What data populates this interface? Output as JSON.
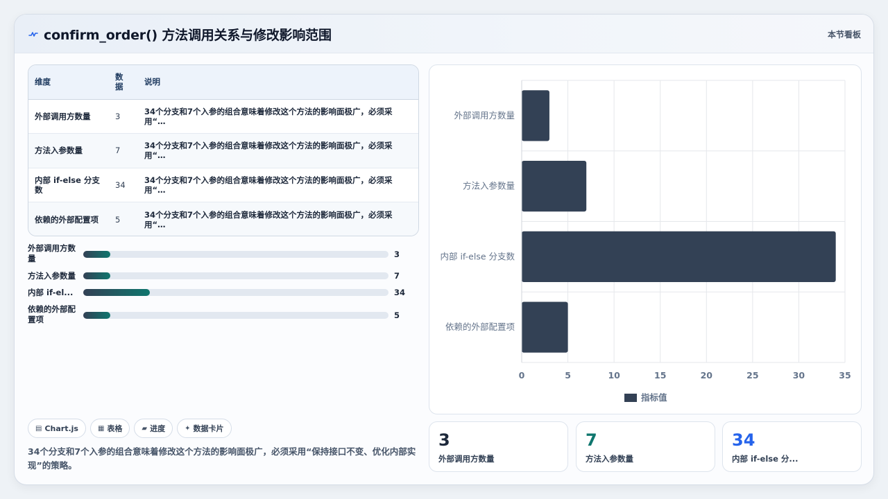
{
  "header": {
    "title": "confirm_order() 方法调用关系与修改影响范围",
    "tag": "本节看板"
  },
  "table": {
    "headers": [
      "维度",
      "数据",
      "说明"
    ],
    "rows": [
      {
        "dim": "外部调用方数量",
        "value": "3",
        "desc": "34个分支和7个入参的组合意味着修改这个方法的影响面极广，必须采用“…"
      },
      {
        "dim": "方法入参数量",
        "value": "7",
        "desc": "34个分支和7个入参的组合意味着修改这个方法的影响面极广，必须采用“…"
      },
      {
        "dim": "内部 if-else 分支数",
        "value": "34",
        "desc": "34个分支和7个入参的组合意味着修改这个方法的影响面极广，必须采用“…"
      },
      {
        "dim": "依赖的外部配置项",
        "value": "5",
        "desc": "34个分支和7个入参的组合意味着修改这个方法的影响面极广，必须采用“…"
      }
    ]
  },
  "progress": [
    {
      "label": "外部调用方数量",
      "value": 3,
      "fraction": 0.0882
    },
    {
      "label": "方法入参数量",
      "value": 7,
      "fraction": 0.0882
    },
    {
      "label": "内部 if-el...",
      "value": 34,
      "fraction": 0.2182
    },
    {
      "label": "依赖的外部配置项",
      "value": 5,
      "fraction": 0.0882
    }
  ],
  "chips": [
    {
      "icon": "chart-icon",
      "label": "Chart.js"
    },
    {
      "icon": "table-icon",
      "label": "表格"
    },
    {
      "icon": "progress-icon",
      "label": "进度"
    },
    {
      "icon": "sparkle-icon",
      "label": "数据卡片"
    }
  ],
  "footnote": "34个分支和7个入参的组合意味着修改这个方法的影响面极广，必须采用“保持接口不变、优化内部实现”的策略。",
  "stats": [
    {
      "value": "3",
      "label": "外部调用方数量",
      "color": "#1e293b"
    },
    {
      "value": "7",
      "label": "方法入参数量",
      "color": "#0f766e"
    },
    {
      "value": "34",
      "label": "内部 if-else 分...",
      "color": "#2563eb"
    }
  ],
  "chart_data": {
    "type": "bar",
    "orientation": "horizontal",
    "categories": [
      "外部调用方数量",
      "方法入参数量",
      "内部 if-else 分支数",
      "依赖的外部配置项"
    ],
    "series": [
      {
        "name": "指标值",
        "values": [
          3,
          7,
          34,
          5
        ]
      }
    ],
    "xlim": [
      0,
      35
    ],
    "xticks": [
      0,
      5,
      10,
      15,
      20,
      25,
      30,
      35
    ],
    "grid": true,
    "legend": "bottom",
    "bar_color": "#334155"
  }
}
